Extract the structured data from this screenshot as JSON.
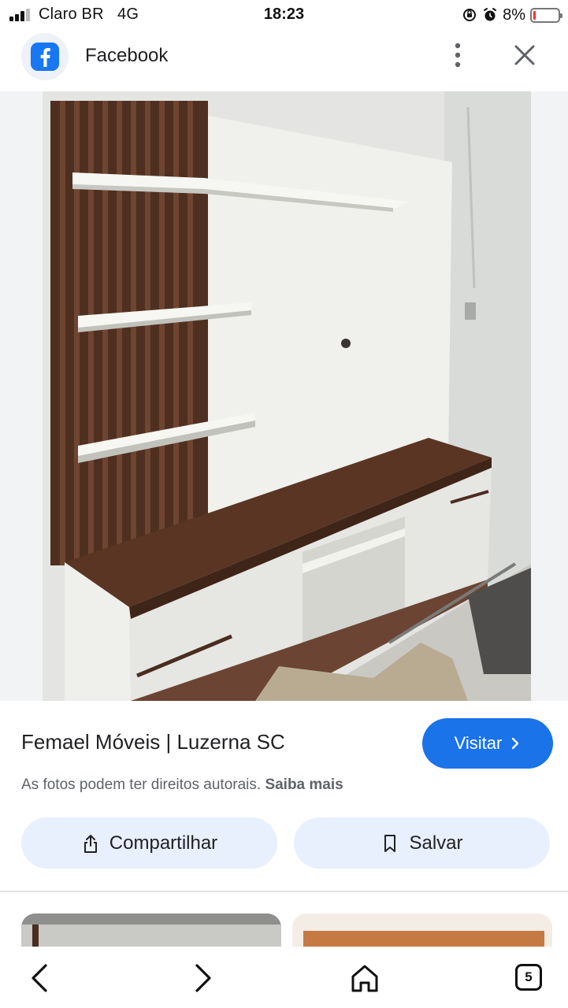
{
  "status_bar": {
    "carrier": "Claro BR",
    "network": "4G",
    "time": "18:23",
    "battery_percent": "8%",
    "battery_level": 0.08,
    "icons": [
      "signal-icon",
      "screen-rotation-lock-icon",
      "alarm-icon",
      "battery-icon"
    ]
  },
  "app_bar": {
    "title": "Facebook",
    "icons": [
      "facebook-logo-icon",
      "more-vert-icon",
      "close-icon"
    ]
  },
  "result": {
    "source": "Femael Móveis | Luzerna SC",
    "visit_label": "Visitar",
    "copyright_text": "As fotos podem ter direitos autorais.",
    "learn_more": "Saiba mais",
    "share_label": "Compartilhar",
    "save_label": "Salvar",
    "accent_color": "#1a73e8"
  },
  "bottom_nav": {
    "tab_count": "5",
    "icons": [
      "back-icon",
      "forward-icon",
      "home-icon",
      "tabs-icon"
    ]
  }
}
